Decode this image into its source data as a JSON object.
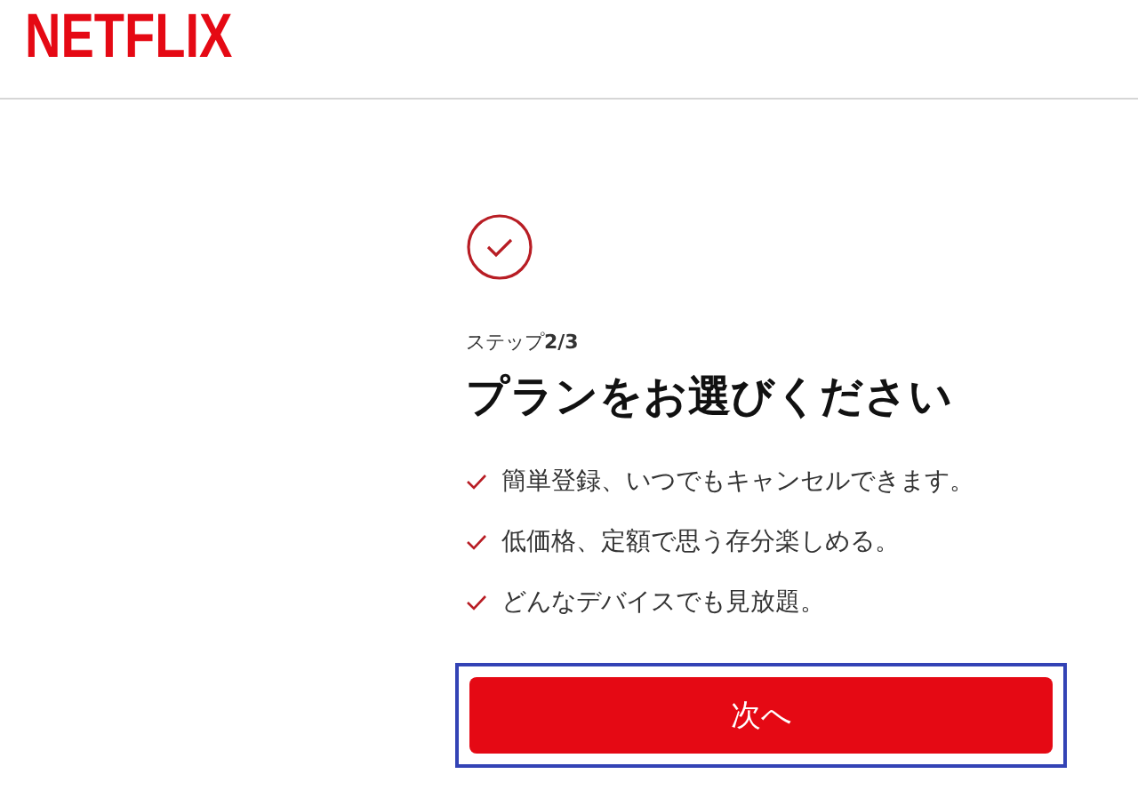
{
  "header": {
    "logo": "NETFLIX"
  },
  "step": {
    "label": "ステップ",
    "count": "2/3"
  },
  "title": "プランをお選びください",
  "benefits": [
    "簡単登録、いつでもキャンセルできます。",
    "低価格、定額で思う存分楽しめる。",
    "どんなデバイスでも見放題。"
  ],
  "next_button": {
    "label": "次へ",
    "highlighted": true
  }
}
